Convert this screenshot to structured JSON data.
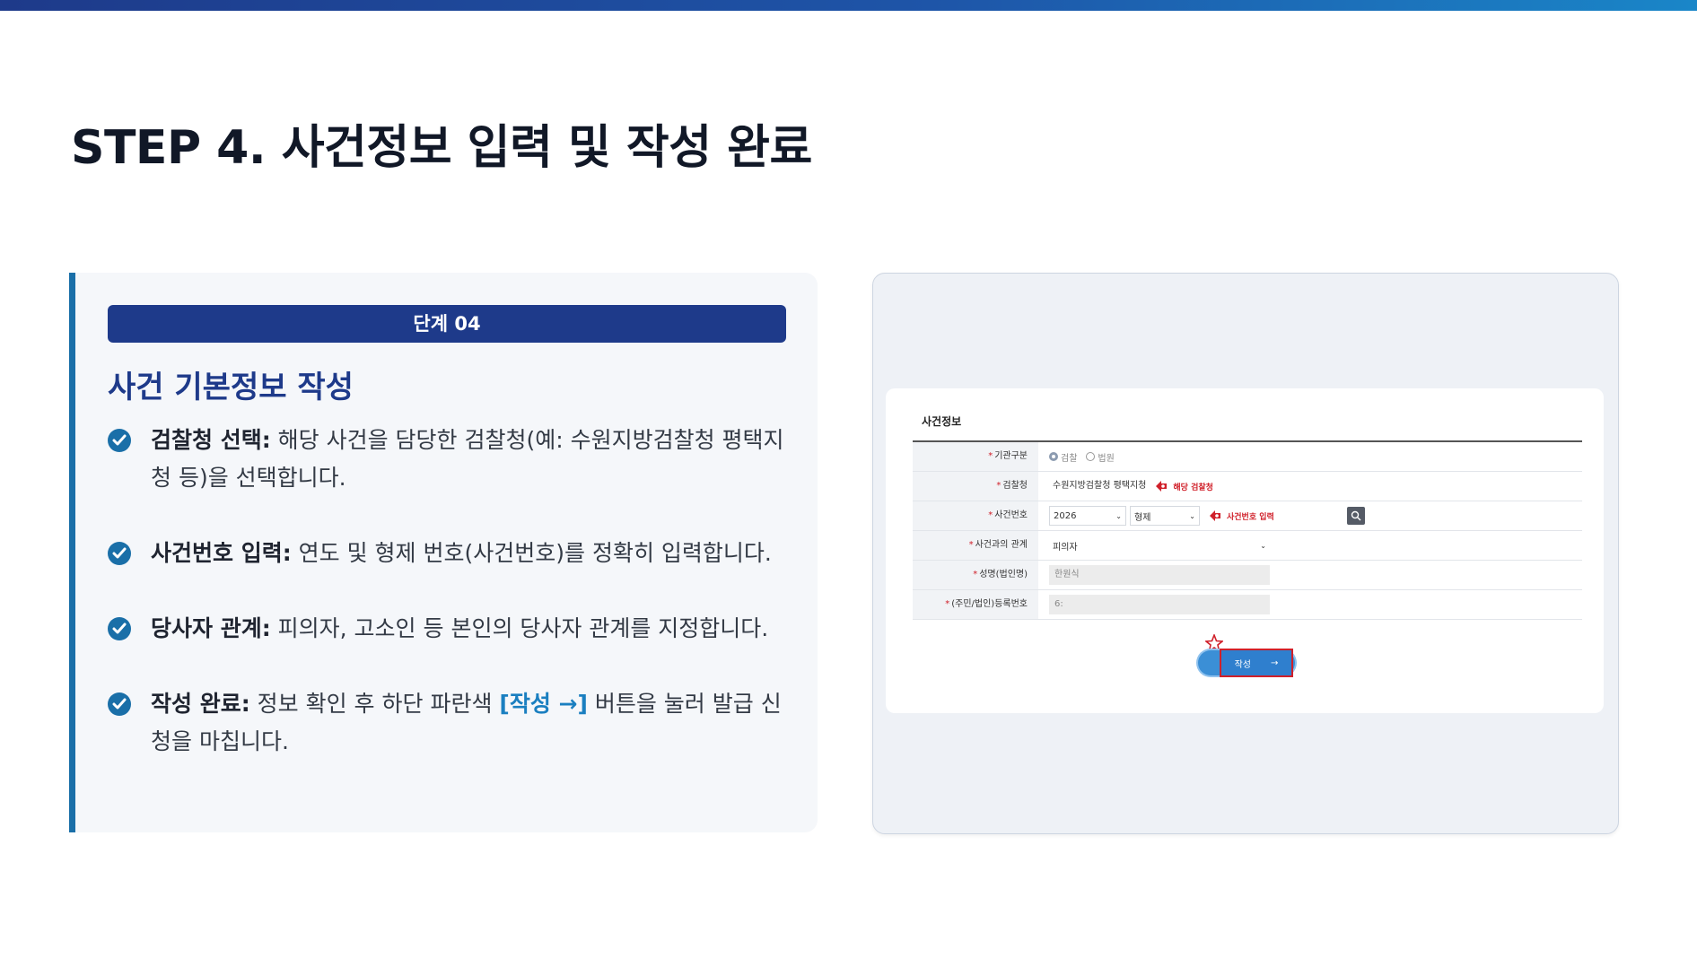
{
  "page": {
    "title": "STEP 4. 사건정보 입력 및 작성 완료"
  },
  "step": {
    "badge": "단계 04",
    "heading": "사건 기본정보 작성",
    "items": [
      {
        "term": "검찰청 선택:",
        "text": " 해당 사건을 담당한 검찰청(예: 수원지방검찰청 평택지청 등)을 선택합니다."
      },
      {
        "term": "사건번호 입력:",
        "text": " 연도 및 형제 번호(사건번호)를 정확히 입력합니다."
      },
      {
        "term": "당사자 관계:",
        "text": " 피의자, 고소인 등 본인의 당사자 관계를 지정합니다."
      },
      {
        "term": "작성 완료:",
        "text_before": " 정보 확인 후 하단 파란색 ",
        "highlight": "[작성 →]",
        "text_after": " 버튼을 눌러 발급 신청을 마칩니다."
      }
    ]
  },
  "screenshot": {
    "form_title": "사건정보",
    "rows": {
      "agency_type": {
        "label": "기관구분",
        "options": [
          "검찰",
          "법원"
        ],
        "selected": "검찰"
      },
      "prosecutor_office": {
        "label": "검찰청",
        "value": "수원지방검찰청 평택지청",
        "annotation": "해당 검찰청"
      },
      "case_number": {
        "label": "사건번호",
        "year": "2026",
        "type": "형제",
        "annotation": "사건번호 입력"
      },
      "relation": {
        "label": "사건과의 관계",
        "value": "피의자"
      },
      "name": {
        "label": "성명(법인명)",
        "value": "한원식"
      },
      "reg_number": {
        "label": "(주민/법인)등록번호",
        "value": "6:"
      }
    },
    "submit": {
      "label": "작성",
      "arrow": "→"
    }
  },
  "colors": {
    "brand_navy": "#1e3a8a",
    "accent_blue": "#1a6fa8",
    "highlight": "#1a7fc0",
    "annotation_red": "#d0202a"
  }
}
